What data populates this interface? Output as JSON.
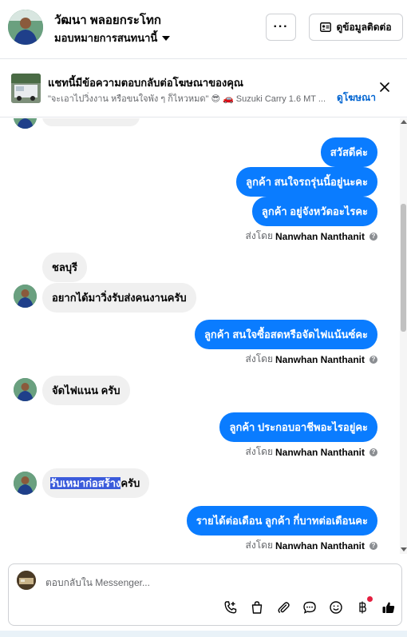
{
  "header": {
    "name": "วัฒนา พลอยกระโทก",
    "assign_label": "มอบหมายการสนทนานี้",
    "more_label": "···",
    "contact_label": "ดูข้อมูลติดต่อ"
  },
  "ad": {
    "title": "แชทนี้มีข้อความตอบกลับต่อโฆษณาของคุณ",
    "subtitle": "\"จะเอาไปวิ่งงาน หรือขนใจพัง ๆ ก็ไหวหมด\" 😎 🚗 Suzuki Carry 1.6 MT ...",
    "link": "ดูโฆษณา"
  },
  "messages": {
    "m1": "สวัสดีค่ะ",
    "m2": "ลูกค้า สนใจรถรุ่นนี้อยู่นะคะ",
    "m3": "ลูกค้า อยู่จังหวัดอะไรคะ",
    "sent_prefix": "ส่งโดย",
    "sender": "Nanwhan Nanthanit",
    "m4": "ชลบุรี",
    "m5": "อยากได้มาวิ่งรับส่งคนงานครับ",
    "m6": "ลูกค้า สนใจซื้อสดหรือจัดไฟแน้นซ์คะ",
    "m7": "จัดไฟแนน ครับ",
    "m8": "ลูกค้า ประกอบอาชีพอะไรอยู่คะ",
    "m9_highlight": "รับเหมาก่อสร้าง",
    "m9_rest": "ครับ",
    "m10": "รายได้ต่อเดือน  ลูกค้า กี่บาทต่อเดือนคะ"
  },
  "composer": {
    "placeholder": "ตอบกลับใน Messenger..."
  }
}
